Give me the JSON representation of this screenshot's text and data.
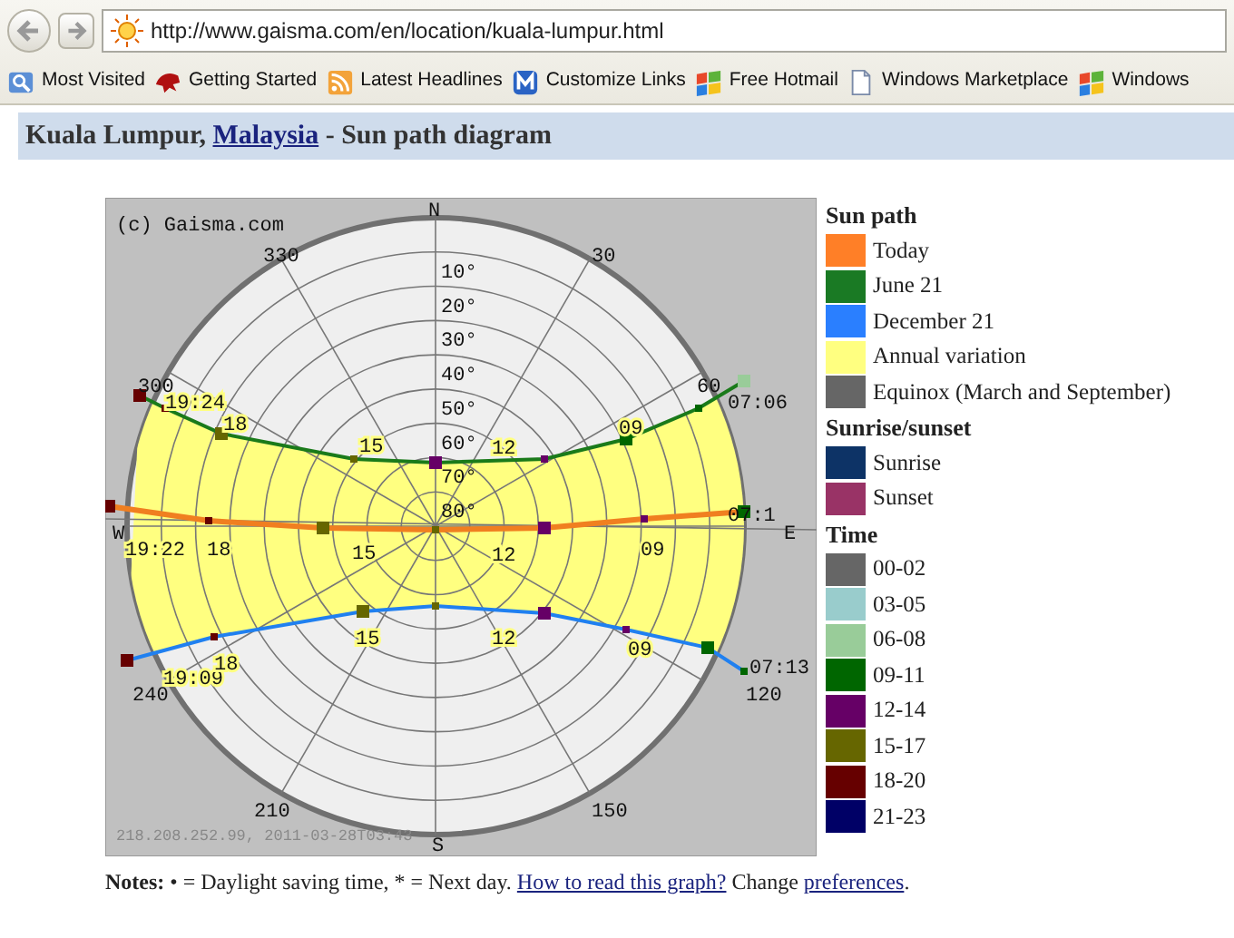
{
  "browser": {
    "url": "http://www.gaisma.com/en/location/kuala-lumpur.html",
    "bookmarks": [
      "Most Visited",
      "Getting Started",
      "Latest Headlines",
      "Customize Links",
      "Free Hotmail",
      "Windows Marketplace",
      "Windows"
    ]
  },
  "heading": {
    "place": "Kuala Lumpur,",
    "country_link": "Malaysia",
    "rest": "- Sun path diagram"
  },
  "diagram": {
    "copyright": "(c) Gaisma.com",
    "stamp": "218.208.252.99, 2011-03-28T03:43",
    "compass": [
      "N",
      "S",
      "W",
      "E"
    ],
    "azimuths": [
      "330",
      "30",
      "300",
      "60",
      "240",
      "120",
      "210",
      "150"
    ],
    "altitudes": [
      "10°",
      "20°",
      "30°",
      "40°",
      "50°",
      "60°",
      "70°",
      "80°"
    ],
    "paths": [
      {
        "color": "#1a7a1a",
        "sunset": "19:24",
        "sunrise": "07:06",
        "hours": [
          "18",
          "15",
          "12",
          "09"
        ]
      },
      {
        "color": "#f07f20",
        "sunset": "19:22",
        "sunrise": "07:1",
        "hours": [
          "18",
          "15",
          "12",
          "09"
        ]
      },
      {
        "color": "#2080f0",
        "sunset": "19:09",
        "sunrise": "07:13",
        "hours": [
          "18",
          "15",
          "12",
          "09"
        ]
      }
    ]
  },
  "legend": [
    {
      "title": "Sun path",
      "items": [
        {
          "label": "Today",
          "color": "#ff7f27"
        },
        {
          "label": "June 21",
          "color": "#1a7a24"
        },
        {
          "label": "December 21",
          "color": "#2a7fff"
        },
        {
          "label": "Annual variation",
          "color": "#ffff80"
        },
        {
          "label": "Equinox (March and September)",
          "color": "#666666"
        }
      ]
    },
    {
      "title": "Sunrise/sunset",
      "items": [
        {
          "label": "Sunrise",
          "color": "#0d3366"
        },
        {
          "label": "Sunset",
          "color": "#993366"
        }
      ]
    },
    {
      "title": "Time",
      "items": [
        {
          "label": "00-02",
          "color": "#666666"
        },
        {
          "label": "03-05",
          "color": "#99cccc"
        },
        {
          "label": "06-08",
          "color": "#99cc99"
        },
        {
          "label": "09-11",
          "color": "#006600"
        },
        {
          "label": "12-14",
          "color": "#660066"
        },
        {
          "label": "15-17",
          "color": "#666600"
        },
        {
          "label": "18-20",
          "color": "#660000"
        },
        {
          "label": "21-23",
          "color": "#000066"
        }
      ]
    }
  ],
  "notes": {
    "text": "**Notes:** • = Daylight saving time, * = Next day.",
    "help_link": "How to read this graph?",
    "middle": "Change",
    "prefs_link": "preferences",
    "end": "."
  }
}
